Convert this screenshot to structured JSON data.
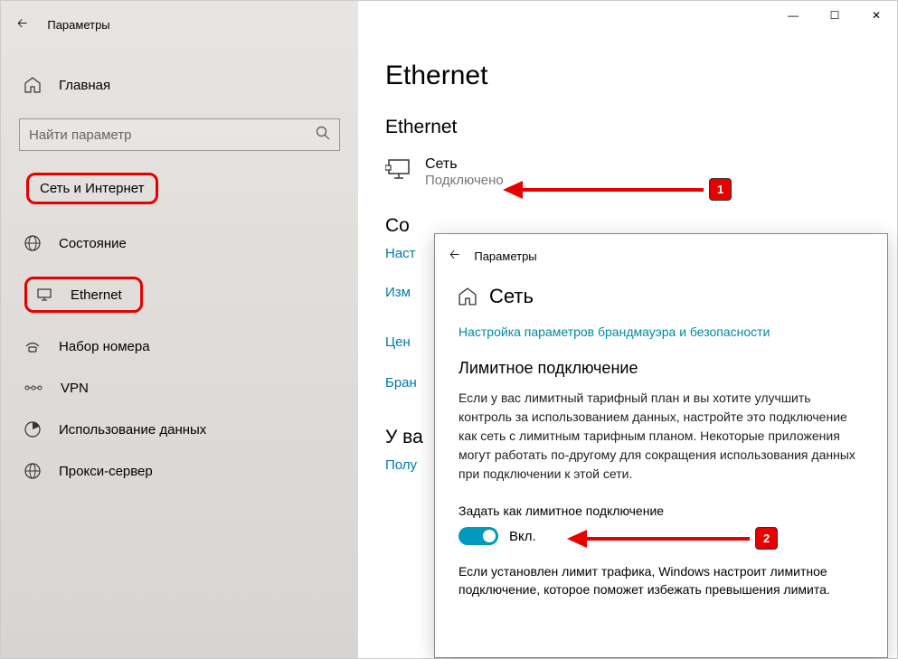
{
  "titlebar": {
    "title": "Параметры"
  },
  "sidebar": {
    "home": "Главная",
    "searchPlaceholder": "Найти параметр",
    "category": "Сеть и Интернет",
    "items": [
      {
        "label": "Состояние"
      },
      {
        "label": "Ethernet"
      },
      {
        "label": "Набор номера"
      },
      {
        "label": "VPN"
      },
      {
        "label": "Использование данных"
      },
      {
        "label": "Прокси-сервер"
      }
    ]
  },
  "main": {
    "pageTitle": "Ethernet",
    "sectionTitle": "Ethernet",
    "connection": {
      "name": "Сеть",
      "status": "Подключено"
    },
    "cutHeading1": "Со",
    "link1": "Наст",
    "link2": "Изм",
    "link3": "Цен",
    "link4": "Бран",
    "cutHeading2": "У ва",
    "link5": "Полу"
  },
  "popup": {
    "titlebar": "Параметры",
    "heading": "Сеть",
    "link": "Настройка параметров брандмауэра и безопасности",
    "subheading": "Лимитное подключение",
    "description": "Если у вас лимитный тарифный план и вы хотите улучшить контроль за использованием данных, настройте это подключение как сеть с лимитным тарифным планом. Некоторые приложения могут работать по-другому для сокращения использования данных при подключении к этой сети.",
    "toggleLabel": "Задать как лимитное подключение",
    "toggleState": "Вкл.",
    "note": "Если установлен лимит трафика, Windows настроит лимитное подключение, которое поможет избежать превышения лимита."
  },
  "annotations": {
    "badge1": "1",
    "badge2": "2"
  }
}
